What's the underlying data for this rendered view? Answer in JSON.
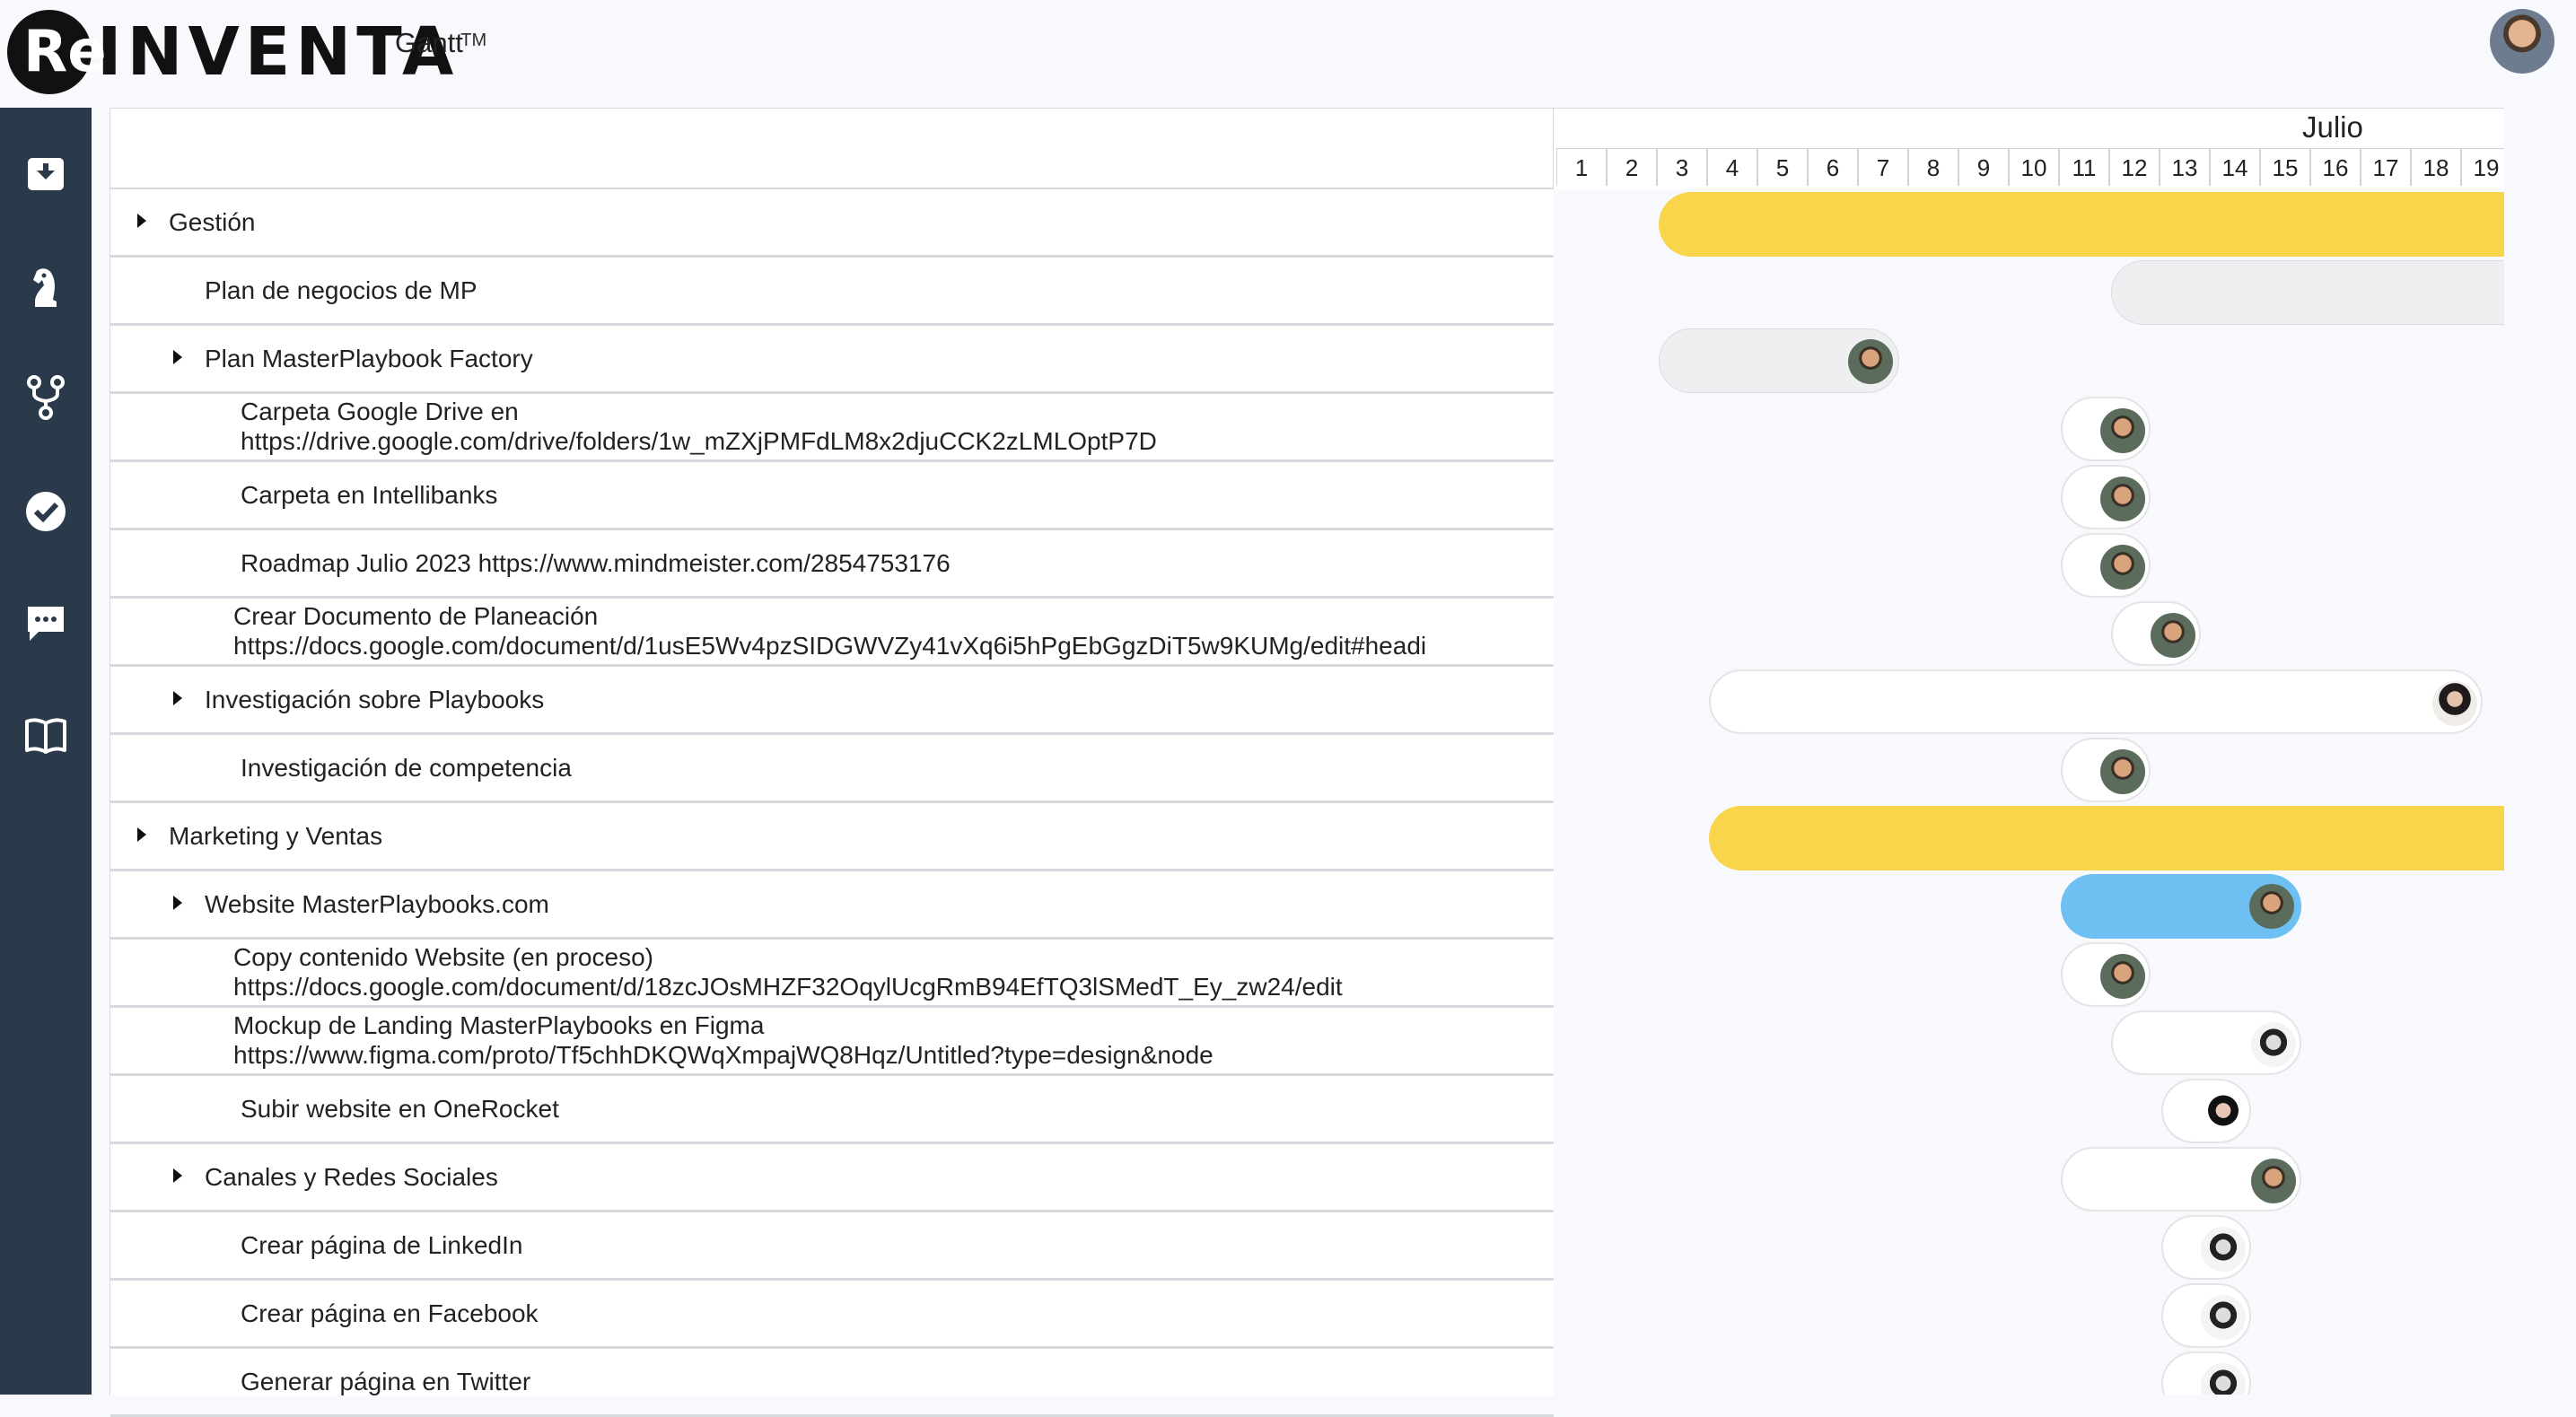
{
  "header": {
    "logo_text": "INVENTA",
    "logo_mark": "Re",
    "tm": "TM",
    "title": "Gantt"
  },
  "sidebar": {
    "icons": [
      "inbox-icon",
      "chess-knight-icon",
      "fork-icon",
      "check-circle-icon",
      "chat-icon",
      "book-icon"
    ]
  },
  "tasks": [
    {
      "label": "Gestión",
      "line2": "",
      "level": 0,
      "caret": true
    },
    {
      "label": "Plan de negocios de MP",
      "line2": "",
      "level": 1,
      "caret": false
    },
    {
      "label": "Plan MasterPlaybook Factory",
      "line2": "",
      "level": 1,
      "caret": true
    },
    {
      "label": "Carpeta Google Drive en",
      "line2": "https://drive.google.com/drive/folders/1w_mZXjPMFdLM8x2djuCCK2zLMLOptP7D",
      "level": 2,
      "caret": false
    },
    {
      "label": "Carpeta en Intellibanks",
      "line2": "",
      "level": 2,
      "caret": false
    },
    {
      "label": "Roadmap Julio 2023 https://www.mindmeister.com/2854753176",
      "line2": "",
      "level": 2,
      "caret": false
    },
    {
      "label": "Crear Documento de Planeación",
      "line2": "https://docs.google.com/document/d/1usE5Wv4pzSIDGWVZy41vXq6i5hPgEbGgzDiT5w9KUMg/edit#headi",
      "level": 2,
      "caret": false
    },
    {
      "label": "Investigación sobre Playbooks",
      "line2": "",
      "level": 1,
      "caret": true
    },
    {
      "label": "Investigación de competencia",
      "line2": "",
      "level": 2,
      "caret": false
    },
    {
      "label": "Marketing y Ventas",
      "line2": "",
      "level": 0,
      "caret": true
    },
    {
      "label": "Website MasterPlaybooks.com",
      "line2": "",
      "level": 1,
      "caret": true
    },
    {
      "label": "Copy contenido Website (en proceso)",
      "line2": "https://docs.google.com/document/d/18zcJOsMHZF32OqylUcgRmB94EfTQ3lSMedT_Ey_zw24/edit",
      "level": 2,
      "caret": false
    },
    {
      "label": "Mockup de Landing MasterPlaybooks en Figma",
      "line2": "https://www.figma.com/proto/Tf5chhDKQWqXmpajWQ8Hqz/Untitled?type=design&node",
      "level": 2,
      "caret": false
    },
    {
      "label": "Subir website en OneRocket",
      "line2": "",
      "level": 2,
      "caret": false
    },
    {
      "label": "Canales y Redes Sociales",
      "line2": "",
      "level": 1,
      "caret": true
    },
    {
      "label": "Crear página de LinkedIn",
      "line2": "",
      "level": 2,
      "caret": false
    },
    {
      "label": "Crear página en Facebook",
      "line2": "",
      "level": 2,
      "caret": false
    },
    {
      "label": "Generar página en Twitter",
      "line2": "",
      "level": 2,
      "caret": false
    }
  ],
  "timeline": {
    "month": "Julio",
    "days": [
      "1",
      "2",
      "3",
      "4",
      "5",
      "6",
      "7",
      "8",
      "9",
      "10",
      "11",
      "12",
      "13",
      "14",
      "15",
      "16",
      "17",
      "18",
      "19"
    ]
  },
  "bars": [
    {
      "row": 0,
      "start": 3,
      "end": 19.5,
      "style": "yellow",
      "avatar": ""
    },
    {
      "row": 1,
      "start": 12,
      "end": 19.5,
      "style": "grey-open",
      "avatar": ""
    },
    {
      "row": 2,
      "start": 3,
      "end": 6.9,
      "style": "grey",
      "avatar": "man"
    },
    {
      "row": 3,
      "start": 11,
      "end": 11.9,
      "style": "white",
      "avatar": "man"
    },
    {
      "row": 4,
      "start": 11,
      "end": 11.9,
      "style": "white",
      "avatar": "man"
    },
    {
      "row": 5,
      "start": 11,
      "end": 11.9,
      "style": "white",
      "avatar": "man"
    },
    {
      "row": 6,
      "start": 12,
      "end": 12.9,
      "style": "white",
      "avatar": "man"
    },
    {
      "row": 7,
      "start": 4,
      "end": 18.5,
      "style": "white",
      "avatar": "woman"
    },
    {
      "row": 8,
      "start": 11,
      "end": 11.9,
      "style": "white",
      "avatar": "man"
    },
    {
      "row": 9,
      "start": 4,
      "end": 19.5,
      "style": "yellow",
      "avatar": ""
    },
    {
      "row": 10,
      "start": 11,
      "end": 14.9,
      "style": "blue",
      "avatar": "man"
    },
    {
      "row": 11,
      "start": 11,
      "end": 11.9,
      "style": "white",
      "avatar": "man"
    },
    {
      "row": 12,
      "start": 12,
      "end": 14.9,
      "style": "white",
      "avatar": "woman2"
    },
    {
      "row": 13,
      "start": 13,
      "end": 13.9,
      "style": "white",
      "avatar": "woman3"
    },
    {
      "row": 14,
      "start": 11,
      "end": 14.9,
      "style": "white",
      "avatar": "man"
    },
    {
      "row": 15,
      "start": 13,
      "end": 13.9,
      "style": "white",
      "avatar": "woman2"
    },
    {
      "row": 16,
      "start": 13,
      "end": 13.9,
      "style": "white",
      "avatar": "woman2"
    },
    {
      "row": 17,
      "start": 13,
      "end": 13.9,
      "style": "white",
      "avatar": "woman2"
    }
  ]
}
